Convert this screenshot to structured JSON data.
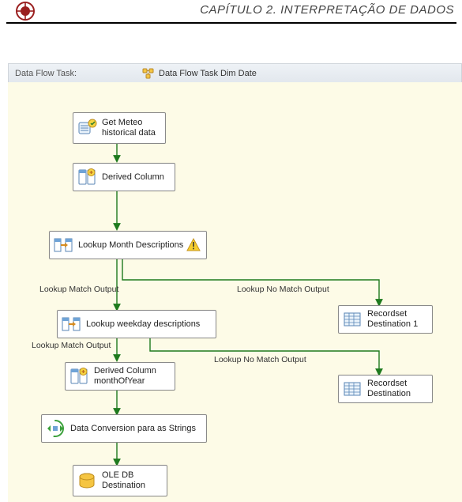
{
  "header": {
    "chapter_title": "CAPÍTULO 2. INTERPRETAÇÃO DE DADOS"
  },
  "toolbar": {
    "label": "Data Flow Task:",
    "task_name": "Data Flow Task Dim Date"
  },
  "nodes": {
    "getMeteo": "Get Meteo\nhistorical data",
    "derivedCol": "Derived Column",
    "lookupMonth": "Lookup Month Descriptions",
    "lookupWeekday": "Lookup weekday descriptions",
    "derivedMonth": "Derived Column\nmonthOfYear",
    "dataConversion": "Data Conversion para as Strings",
    "oledb": "OLE DB\nDestination",
    "recordset1": "Recordset\nDestination 1",
    "recordset": "Recordset\nDestination"
  },
  "edges": {
    "match1": "Lookup Match Output",
    "nomatch1": "Lookup No Match Output",
    "match2": "Lookup Match Output",
    "nomatch2": "Lookup No Match Output"
  }
}
